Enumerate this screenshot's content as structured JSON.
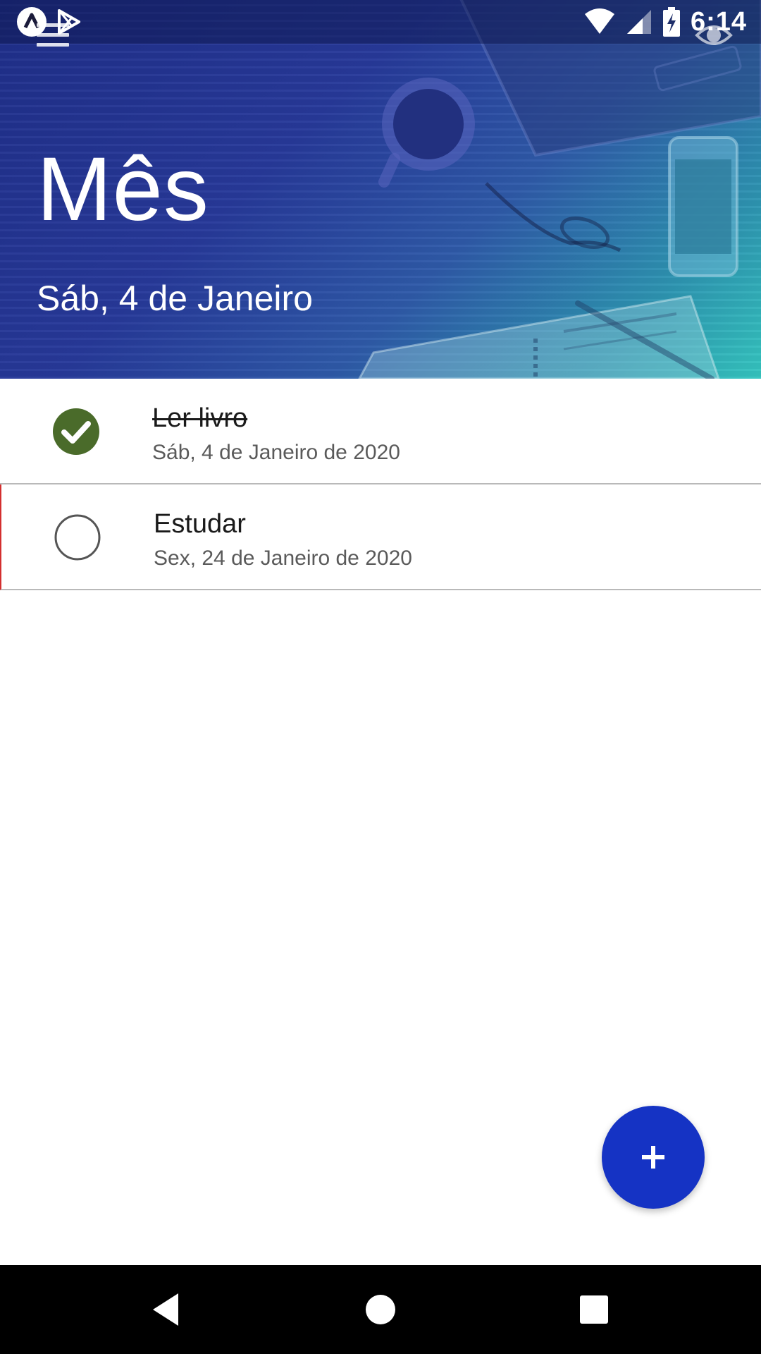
{
  "status_bar": {
    "time": "6:14",
    "icons": [
      "app-notification-icon",
      "play-store-icon",
      "wifi-icon",
      "cell-signal-icon",
      "battery-charging-icon"
    ]
  },
  "header": {
    "title": "Mês",
    "subtitle": "Sáb, 4 de Janeiro",
    "menu_icon": "hamburger-menu-icon",
    "action_icon": "eye-icon",
    "colors": {
      "gradient_start": "#1f2f8a",
      "gradient_end": "#35c6c0"
    }
  },
  "tasks": [
    {
      "title": "Ler livro",
      "date": "Sáb, 4 de Janeiro de 2020",
      "done": true,
      "check_color": "#4a6b2a"
    },
    {
      "title": "Estudar",
      "date": "Sex, 24 de Janeiro de 2020",
      "done": false,
      "overdue_marker_color": "#d32f2f"
    }
  ],
  "fab": {
    "label": "+",
    "color": "#1533c4"
  },
  "nav_bar": {
    "buttons": [
      "back-icon",
      "home-icon",
      "recents-icon"
    ]
  }
}
